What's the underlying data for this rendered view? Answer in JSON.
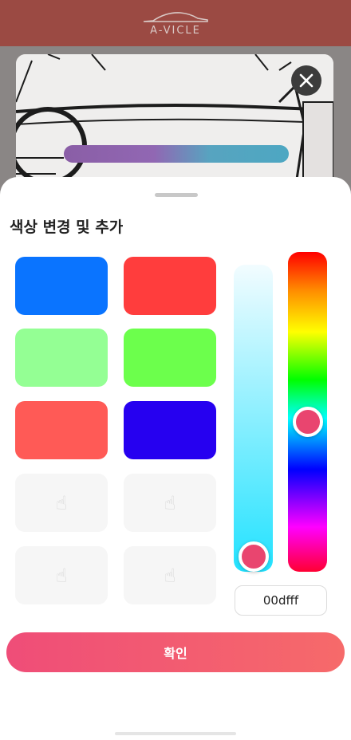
{
  "app": {
    "brand": "A-VICLE"
  },
  "preview": {
    "close_icon": "close-icon"
  },
  "sheet": {
    "title": "색상 변경 및 추가",
    "swatches": [
      {
        "color": "#0a74ff"
      },
      {
        "color": "#ff3d3d"
      },
      {
        "color": "#94ff94"
      },
      {
        "color": "#6cff4c"
      },
      {
        "color": "#ff5a56"
      },
      {
        "color": "#2600f0"
      },
      {
        "color": "",
        "icon": "tap-hand-icon"
      },
      {
        "color": "",
        "icon": "tap-hand-icon"
      },
      {
        "color": "",
        "icon": "tap-hand-icon"
      },
      {
        "color": "",
        "icon": "tap-hand-icon"
      }
    ],
    "saturation_slider": {
      "top_color": "#f2fcff",
      "bottom_color": "#22e2ff",
      "value": 0.95
    },
    "hue_slider": {
      "value": 0.53
    },
    "thumb_color": "#e9456f",
    "hex_value": "00dfff",
    "confirm_label": "확인"
  }
}
